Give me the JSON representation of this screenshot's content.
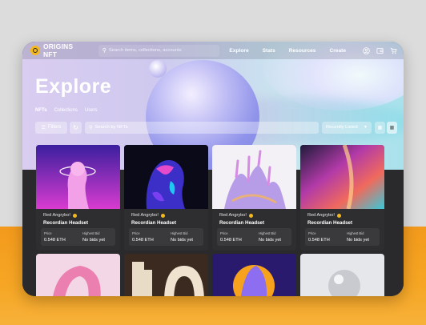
{
  "brand": {
    "name": "ORIGINS NFT",
    "accent": "#f5b81c"
  },
  "nav": {
    "search_placeholder": "Search items, collections, accounts",
    "links": [
      "Explore",
      "Stats",
      "Resources",
      "Create"
    ],
    "icons": [
      "user-icon",
      "wallet-icon",
      "cart-icon"
    ]
  },
  "page": {
    "title": "Explore",
    "tabs": [
      "NFTs",
      "Collections",
      "Users"
    ],
    "active_tab": "NFTs"
  },
  "filters": {
    "filter_label": "Filters",
    "search_placeholder": "Search by NFTs",
    "sort_label": "Recently Listed"
  },
  "cards": [
    {
      "creator": "Red Angrybo!",
      "name": "Recordian Headset",
      "price_label": "Price",
      "price": "0.548 ETH",
      "bid_label": "Highest Bid",
      "bid": "No bids yet"
    },
    {
      "creator": "Red Angrybo!",
      "name": "Recordian Headset",
      "price_label": "Price",
      "price": "0.548 ETH",
      "bid_label": "Highest Bid",
      "bid": "No bids yet"
    },
    {
      "creator": "Red Angrybo!",
      "name": "Recordian Headset",
      "price_label": "Price",
      "price": "0.548 ETH",
      "bid_label": "Highest Bid",
      "bid": "No bids yet"
    },
    {
      "creator": "Red Angrybo!",
      "name": "Recordian Headset",
      "price_label": "Price",
      "price": "0.548 ETH",
      "bid_label": "Highest Bid",
      "bid": "No bids yet"
    }
  ]
}
